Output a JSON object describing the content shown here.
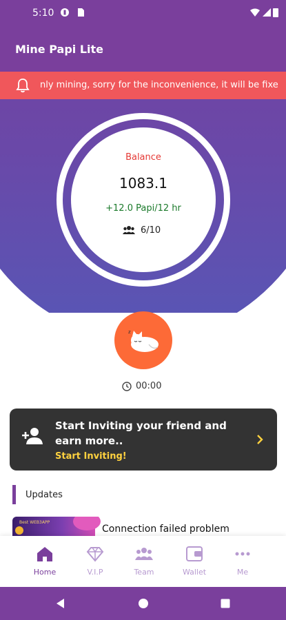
{
  "status_bar": {
    "time": "5:10"
  },
  "app": {
    "title": "Mine Papi Lite"
  },
  "announcement": {
    "text": "nly mining, sorry for the inconvenience, it will be fixe"
  },
  "balance": {
    "label": "Balance",
    "value": "1083.1",
    "rate": "+12.0 Papi/12 hr",
    "team": "6/10"
  },
  "timer": {
    "value": "00:00"
  },
  "invite": {
    "title": "Start Inviting your friend and earn more..",
    "action": "Start Inviting!"
  },
  "updates": {
    "section_title": "Updates",
    "items": [
      {
        "title": "Connection failed problem",
        "thumb_text": "Best WEB3APP"
      }
    ]
  },
  "bottom_nav": {
    "items": [
      {
        "label": "Home",
        "icon": "home-icon"
      },
      {
        "label": "V.I.P",
        "icon": "diamond-icon"
      },
      {
        "label": "Team",
        "icon": "team-icon"
      },
      {
        "label": "Wallet",
        "icon": "wallet-icon"
      },
      {
        "label": "Me",
        "icon": "more-icon"
      }
    ],
    "active_color": "#7a3f9c",
    "inactive_color": "#b79ad0"
  },
  "colors": {
    "primary": "#7a3f9c",
    "accent": "#fd6a37",
    "alert": "#f0575b",
    "gold": "#ffd23f"
  }
}
